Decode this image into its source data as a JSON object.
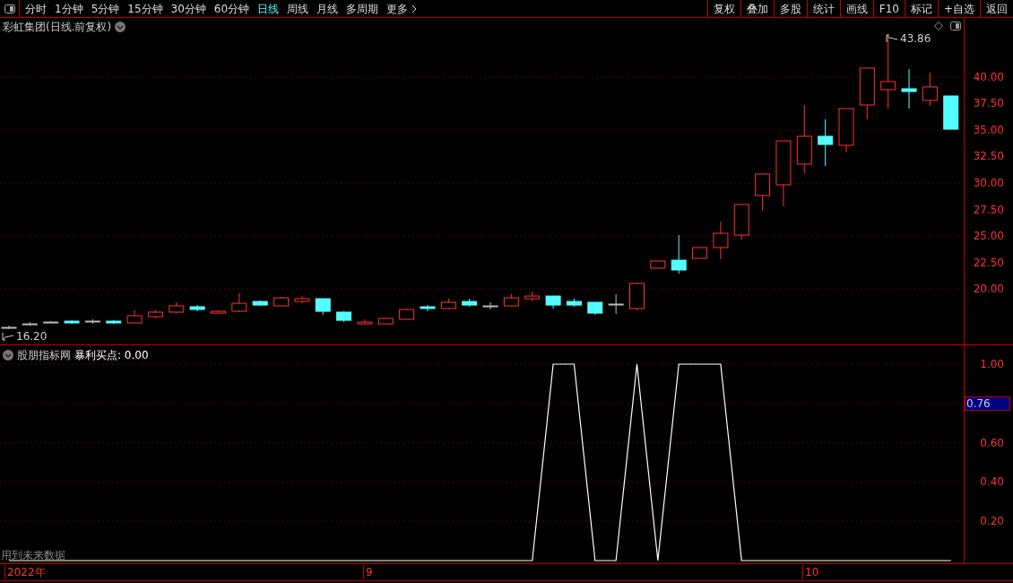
{
  "toolbar": {
    "periods": [
      {
        "label": "分时",
        "selected": false
      },
      {
        "label": "1分钟",
        "selected": false
      },
      {
        "label": "5分钟",
        "selected": false
      },
      {
        "label": "15分钟",
        "selected": false
      },
      {
        "label": "30分钟",
        "selected": false
      },
      {
        "label": "60分钟",
        "selected": false
      },
      {
        "label": "日线",
        "selected": true
      },
      {
        "label": "周线",
        "selected": false
      },
      {
        "label": "月线",
        "selected": false
      },
      {
        "label": "多周期",
        "selected": false
      },
      {
        "label": "更多",
        "selected": false
      }
    ],
    "buttons": [
      "复权",
      "叠加",
      "多股",
      "统计",
      "画线",
      "F10",
      "标记",
      "+自选",
      "返回"
    ]
  },
  "main_chart": {
    "title": "彩虹集团(日线.前复权)",
    "high_label": "43.86",
    "low_label": "16.20",
    "chart_data": {
      "type": "candlestick",
      "grid": true,
      "ylim": [
        14.75,
        45.59
      ],
      "ohlc": [
        [
          16.36,
          16.53,
          16.2,
          16.36
        ],
        [
          16.69,
          16.86,
          16.53,
          16.69
        ],
        [
          16.86,
          16.95,
          16.78,
          16.86
        ],
        [
          16.95,
          17.03,
          16.69,
          16.78
        ],
        [
          16.95,
          17.12,
          16.69,
          16.95
        ],
        [
          16.95,
          17.03,
          16.69,
          16.78
        ],
        [
          16.78,
          17.97,
          16.78,
          17.46
        ],
        [
          17.37,
          17.97,
          17.2,
          17.8
        ],
        [
          17.8,
          18.73,
          17.71,
          18.39
        ],
        [
          18.31,
          18.47,
          17.88,
          18.05
        ],
        [
          17.71,
          17.97,
          17.63,
          17.88
        ],
        [
          17.88,
          19.58,
          17.8,
          18.64
        ],
        [
          18.81,
          18.9,
          18.39,
          18.47
        ],
        [
          18.39,
          19.24,
          18.39,
          19.15
        ],
        [
          18.81,
          19.32,
          18.64,
          19.07
        ],
        [
          19.07,
          19.07,
          17.54,
          17.88
        ],
        [
          17.8,
          17.88,
          16.86,
          17.03
        ],
        [
          16.69,
          17.12,
          16.61,
          16.86
        ],
        [
          16.69,
          17.29,
          16.69,
          17.2
        ],
        [
          17.12,
          18.14,
          17.12,
          18.05
        ],
        [
          18.31,
          18.47,
          17.88,
          18.14
        ],
        [
          18.14,
          19.07,
          18.05,
          18.73
        ],
        [
          18.81,
          19.07,
          18.31,
          18.47
        ],
        [
          18.39,
          18.73,
          18.05,
          18.39
        ],
        [
          18.39,
          19.49,
          18.39,
          19.15
        ],
        [
          19.07,
          19.75,
          18.81,
          19.32
        ],
        [
          19.32,
          19.32,
          18.14,
          18.47
        ],
        [
          18.81,
          19.07,
          18.31,
          18.47
        ],
        [
          18.73,
          18.73,
          17.54,
          17.71
        ],
        [
          18.56,
          19.49,
          17.63,
          18.56
        ],
        [
          18.14,
          20.59,
          17.97,
          20.51
        ],
        [
          21.95,
          22.63,
          21.95,
          22.63
        ],
        [
          22.71,
          25.08,
          21.44,
          21.78
        ],
        [
          22.88,
          23.9,
          22.88,
          23.9
        ],
        [
          23.9,
          26.36,
          22.8,
          25.25
        ],
        [
          25.08,
          27.97,
          24.66,
          27.97
        ],
        [
          28.81,
          30.85,
          27.37,
          30.85
        ],
        [
          29.83,
          33.98,
          27.8,
          33.98
        ],
        [
          31.78,
          37.37,
          30.93,
          34.41
        ],
        [
          34.41,
          36.02,
          31.61,
          33.64
        ],
        [
          33.56,
          37.03,
          32.88,
          37.03
        ],
        [
          37.37,
          40.85,
          36.02,
          40.85
        ],
        [
          38.81,
          43.86,
          37.03,
          39.58
        ],
        [
          38.9,
          40.76,
          37.03,
          38.64
        ],
        [
          37.8,
          40.42,
          37.29,
          39.07
        ],
        [
          38.22,
          38.22,
          35.08,
          35.08
        ]
      ],
      "yticks": [
        {
          "value": 40,
          "label": "40.00"
        },
        {
          "value": 37.5,
          "label": "37.50"
        },
        {
          "value": 35,
          "label": "35.00"
        },
        {
          "value": 32.5,
          "label": "32.50"
        },
        {
          "value": 30,
          "label": "30.00"
        },
        {
          "value": 27.5,
          "label": "27.50"
        },
        {
          "value": 25,
          "label": "25.00"
        },
        {
          "value": 22.5,
          "label": "22.50"
        },
        {
          "value": 20,
          "label": "20.00"
        }
      ]
    }
  },
  "indicator": {
    "name": "股朋指标网",
    "value_text": ": 0.00",
    "cursor_value": "0.76",
    "notice": "用到未来数据",
    "chart_data": {
      "type": "line",
      "grid": true,
      "ylim": [
        -0.0137,
        1.0959
      ],
      "yticks": [
        {
          "value": 1,
          "label": "1.00"
        },
        {
          "value": 0.6,
          "label": "0.60"
        },
        {
          "value": 0.4,
          "label": "0.40"
        },
        {
          "value": 0.2,
          "label": "0.20"
        }
      ],
      "series": [
        {
          "name": "暴利买点",
          "color": "#ffffff",
          "values": [
            0,
            0,
            0,
            0,
            0,
            0,
            0,
            0,
            0,
            0,
            0,
            0,
            0,
            0,
            0,
            0,
            0,
            0,
            0,
            0,
            0,
            0,
            0,
            0,
            0,
            0,
            1,
            1,
            0,
            0,
            1,
            0,
            1,
            1,
            1,
            0,
            0,
            0,
            0,
            0,
            0,
            0,
            0,
            0,
            0,
            0
          ]
        }
      ]
    }
  },
  "date_axis": [
    "2022年",
    "9",
    "10"
  ]
}
